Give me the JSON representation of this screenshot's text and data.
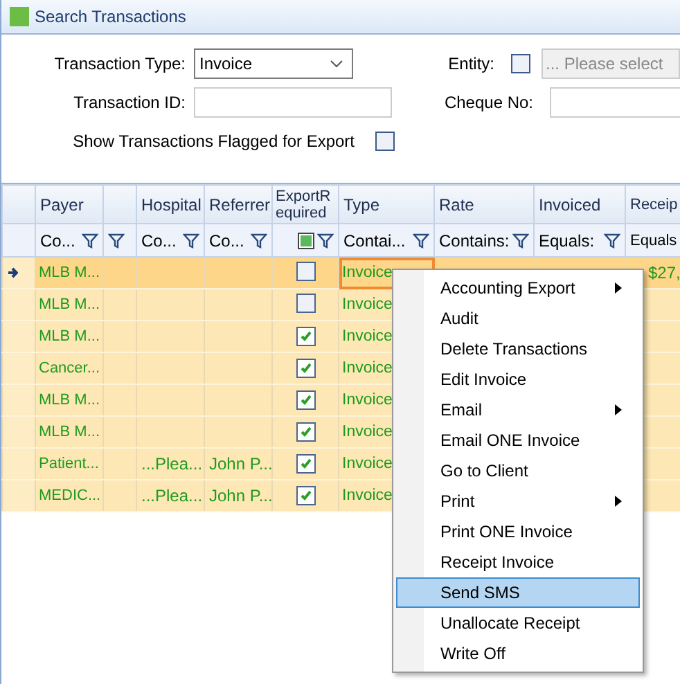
{
  "window": {
    "title": "Search Transactions"
  },
  "form": {
    "transaction_type": {
      "label": "Transaction Type:",
      "value": "Invoice"
    },
    "entity": {
      "label": "Entity:",
      "checked": false,
      "placeholder": "... Please select"
    },
    "transaction_id": {
      "label": "Transaction ID:"
    },
    "cheque_no": {
      "label": "Cheque No:"
    },
    "flagged": {
      "label": "Show Transactions Flagged for Export",
      "checked": false
    }
  },
  "table": {
    "columns": [
      {
        "heading": "Payer",
        "filter": "Co..."
      },
      {},
      {
        "heading": "Hospital",
        "filter": "Co..."
      },
      {
        "heading": "Referrer",
        "filter": "Co..."
      },
      {
        "heading": "ExportRequired",
        "filter_indeterminate": true
      },
      {
        "heading": "Type",
        "filter": "Contai..."
      },
      {
        "heading": "Rate",
        "filter": "Contains:"
      },
      {
        "heading": "Invoiced",
        "filter": "Equals:"
      },
      {
        "heading": "Receip",
        "filter": "Equals"
      }
    ],
    "rows": [
      {
        "selected": true,
        "payer": "MLB M...",
        "export_required": false,
        "type": "Invoice",
        "receipted": "$27,"
      },
      {
        "selected": false,
        "payer": "MLB M...",
        "export_required": false,
        "type": "Invoice"
      },
      {
        "selected": false,
        "payer": "MLB M...",
        "export_required": true,
        "type": "Invoice"
      },
      {
        "selected": false,
        "payer": "Cancer...",
        "export_required": true,
        "type": "Invoice"
      },
      {
        "selected": false,
        "payer": "MLB M...",
        "export_required": true,
        "type": "Invoice"
      },
      {
        "selected": false,
        "payer": "MLB M...",
        "export_required": true,
        "type": "Invoice"
      },
      {
        "selected": false,
        "payer": "Patient...",
        "hospital": "...Plea...",
        "referrer": "John P...",
        "export_required": true,
        "type": "Invoice"
      },
      {
        "selected": false,
        "payer": "MEDIC...",
        "hospital": "...Plea...",
        "referrer": "John P...",
        "export_required": true,
        "type": "Invoice"
      }
    ]
  },
  "context_menu": {
    "items": [
      {
        "label": "Accounting Export",
        "submenu": true,
        "selected": false
      },
      {
        "label": "Audit",
        "submenu": false,
        "selected": false
      },
      {
        "label": "Delete Transactions",
        "submenu": false,
        "selected": false
      },
      {
        "label": "Edit Invoice",
        "submenu": false,
        "selected": false
      },
      {
        "label": "Email",
        "submenu": true,
        "selected": false
      },
      {
        "label": "Email ONE Invoice",
        "submenu": false,
        "selected": false
      },
      {
        "label": "Go to Client",
        "submenu": false,
        "selected": false
      },
      {
        "label": "Print",
        "submenu": true,
        "selected": false
      },
      {
        "label": "Print ONE Invoice",
        "submenu": false,
        "selected": false
      },
      {
        "label": "Receipt Invoice",
        "submenu": false,
        "selected": false
      },
      {
        "label": "Send SMS",
        "submenu": false,
        "selected": true
      },
      {
        "label": "Unallocate Receipt",
        "submenu": false,
        "selected": false
      },
      {
        "label": "Write Off",
        "submenu": false,
        "selected": false
      }
    ]
  }
}
